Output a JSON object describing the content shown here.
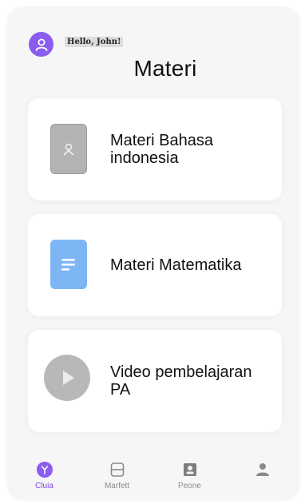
{
  "header": {
    "greeting": "Hello, John!",
    "title": "Materi"
  },
  "cards": [
    {
      "label": "Materi Bahasa indonesia",
      "icon": "person-icon"
    },
    {
      "label": "Materi Matematika",
      "icon": "document-icon"
    },
    {
      "label": "Video pembelajaran PA",
      "icon": "play-icon"
    }
  ],
  "nav": {
    "items": [
      {
        "label": "Cluia",
        "icon": "home-icon",
        "active": true
      },
      {
        "label": "Marfett",
        "icon": "book-icon",
        "active": false
      },
      {
        "label": "Peone",
        "icon": "id-badge-icon",
        "active": false
      },
      {
        "label": "",
        "icon": "profile-icon",
        "active": false
      }
    ]
  },
  "colors": {
    "accent": "#8a5cf0",
    "doc_icon": "#7eb5f5",
    "muted_icon": "#b3b3b3",
    "background": "#f6f6f7"
  }
}
